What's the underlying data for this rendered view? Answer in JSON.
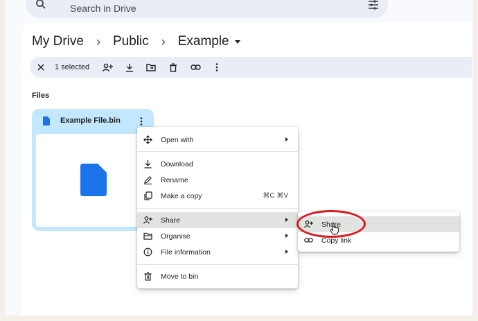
{
  "search": {
    "placeholder": "Search in Drive"
  },
  "breadcrumb": {
    "items": [
      "My Drive",
      "Public",
      "Example"
    ],
    "separator": "›"
  },
  "selection_bar": {
    "count_label": "1 selected",
    "actions": [
      "close-icon",
      "share-icon",
      "download-icon",
      "move-to-folder-icon",
      "delete-icon",
      "link-icon",
      "more-vertical-icon"
    ]
  },
  "files_section": {
    "label": "Files"
  },
  "file_card": {
    "name": "Example File.bin",
    "icon": "file-icon",
    "accent": "#1a73e8",
    "selected_bg": "#c2e7ff"
  },
  "context_menu": {
    "items": [
      {
        "label": "Open with",
        "icon": "open-with-icon",
        "submenu": true
      },
      {
        "label": "Download",
        "icon": "download-icon"
      },
      {
        "label": "Rename",
        "icon": "rename-icon"
      },
      {
        "label": "Make a copy",
        "icon": "copy-icon",
        "shortcut": "⌘C ⌘V"
      },
      {
        "label": "Share",
        "icon": "share-icon",
        "submenu": true,
        "highlighted": true
      },
      {
        "label": "Organise",
        "icon": "folder-icon",
        "submenu": true
      },
      {
        "label": "File information",
        "icon": "info-icon",
        "submenu": true
      },
      {
        "label": "Move to bin",
        "icon": "trash-icon"
      }
    ]
  },
  "share_submenu": {
    "items": [
      {
        "label": "Share",
        "icon": "share-icon",
        "highlighted": true
      },
      {
        "label": "Copy link",
        "icon": "link-icon"
      }
    ]
  },
  "annotation": {
    "ring_color": "#d9181f"
  }
}
